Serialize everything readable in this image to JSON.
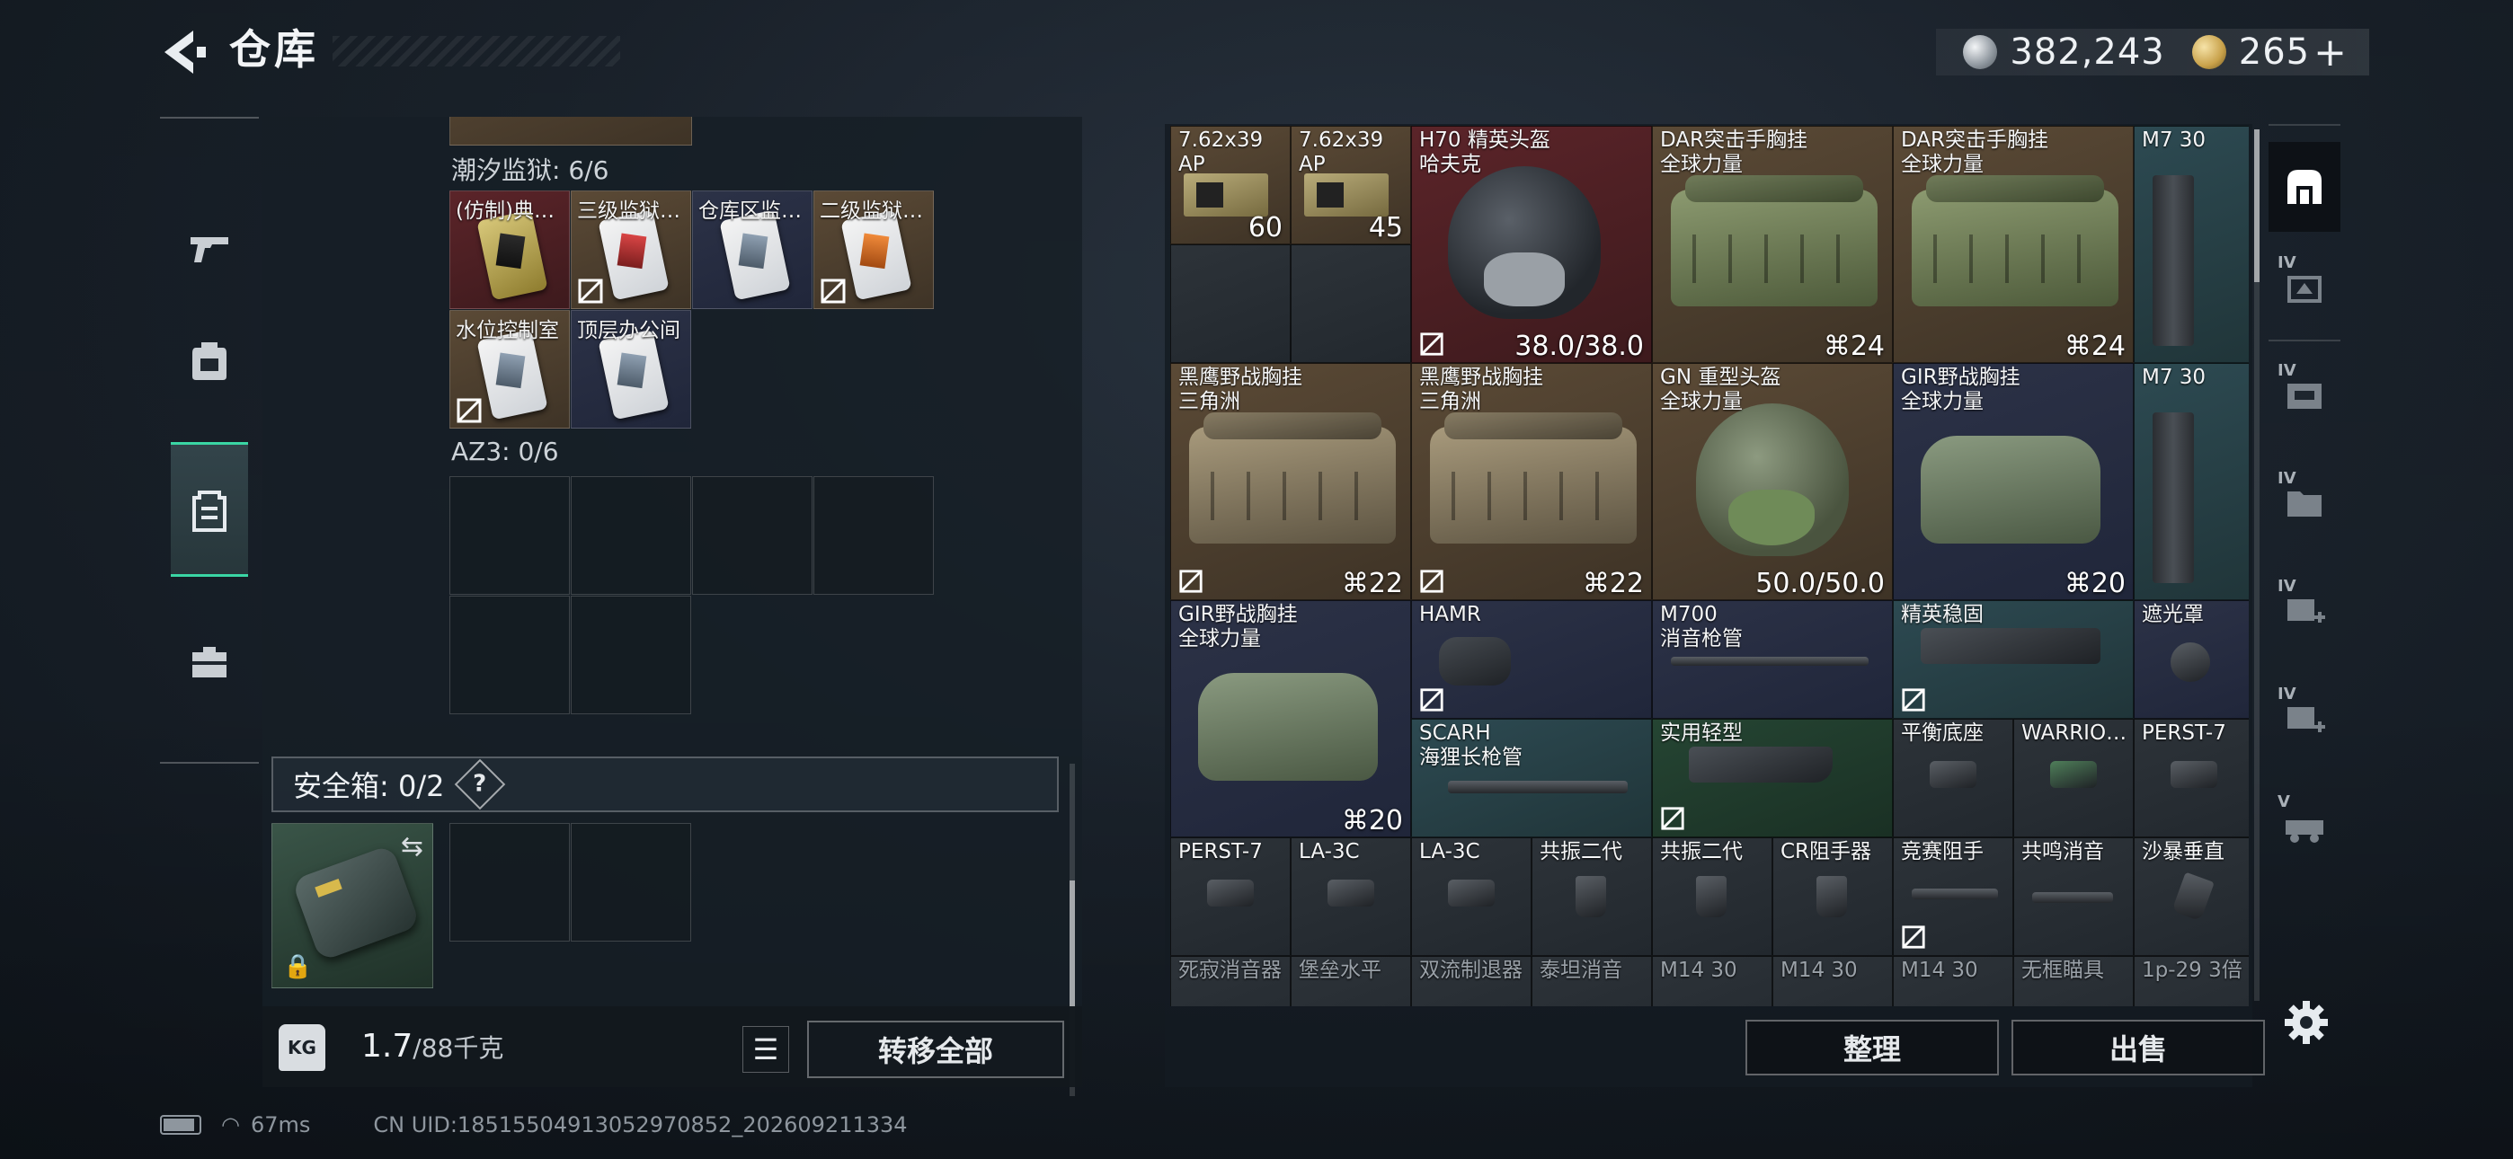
{
  "header": {
    "title": "仓库"
  },
  "currency": {
    "silver": "382,243",
    "gold": "265",
    "gold_plus": "+"
  },
  "left_tabs": [
    {
      "name": "tab-weapons",
      "icon": "pistol-icon"
    },
    {
      "name": "tab-equipment",
      "icon": "backpack-icon"
    },
    {
      "name": "tab-containers",
      "icon": "clipboard-icon",
      "active": true
    },
    {
      "name": "tab-kits",
      "icon": "toolbox-icon"
    }
  ],
  "container": {
    "section_tidal": "潮汐监狱: 6/6",
    "tidal_items": [
      {
        "label": "(仿制)典…",
        "color": "red"
      },
      {
        "label": "三级监狱…",
        "color": "gray"
      },
      {
        "label": "仓库区监…",
        "color": "navy"
      },
      {
        "label": "二级监狱…",
        "color": "brown"
      },
      {
        "label": "水位控制室",
        "color": "brown"
      },
      {
        "label": "顶层办公间",
        "color": "navy"
      }
    ],
    "section_az3": "AZ3: 0/6",
    "safe_label": "安全箱: 0/2",
    "help": "?",
    "swap_icon": "⇆",
    "lock_icon": "🔒"
  },
  "weight": {
    "icon_text": "KG",
    "current": "1.7",
    "max": "/88千克"
  },
  "actions": {
    "list_icon": "☰",
    "transfer_all": "转移全部",
    "sort": "整理",
    "sell": "出售"
  },
  "stash": {
    "items": [
      {
        "id": "ammo1",
        "name": "7.62x39\nAP",
        "qty": "60"
      },
      {
        "id": "ammo2",
        "name": "7.62x39\nAP",
        "qty": "45"
      },
      {
        "id": "h70",
        "name": "H70 精英头盔\n哈夫克",
        "durability": "38.0/38.0"
      },
      {
        "id": "dar1",
        "name": "DAR突击手胸挂\n全球力量",
        "qty": "24"
      },
      {
        "id": "dar2",
        "name": "DAR突击手胸挂\n全球力量",
        "qty": "24"
      },
      {
        "id": "m7a",
        "name": "M7 30"
      },
      {
        "id": "heiying1",
        "name": "黑鹰野战胸挂\n三角洲",
        "qty": "22"
      },
      {
        "id": "heiying2",
        "name": "黑鹰野战胸挂\n三角洲",
        "qty": "22"
      },
      {
        "id": "gn",
        "name": "GN 重型头盔\n全球力量",
        "durability": "50.0/50.0"
      },
      {
        "id": "gir1",
        "name": "GIR野战胸挂\n全球力量",
        "qty": "20"
      },
      {
        "id": "m7b",
        "name": "M7 30"
      },
      {
        "id": "gir2",
        "name": "GIR野战胸挂\n全球力量",
        "qty": "20"
      },
      {
        "id": "hamr",
        "name": "HAMR"
      },
      {
        "id": "m700",
        "name": "M700\n消音枪管"
      },
      {
        "id": "jingying",
        "name": "精英稳固"
      },
      {
        "id": "zheguang",
        "name": "遮光罩"
      },
      {
        "id": "scarh",
        "name": "SCARH\n海狸长枪管"
      },
      {
        "id": "shiyong",
        "name": "实用轻型"
      },
      {
        "id": "pingheng",
        "name": "平衡底座"
      },
      {
        "id": "warrior",
        "name": "WARRIO…"
      },
      {
        "id": "perst1",
        "name": "PERST-7"
      },
      {
        "id": "perst2",
        "name": "PERST-7"
      },
      {
        "id": "la3c1",
        "name": "LA-3C"
      },
      {
        "id": "la3c2",
        "name": "LA-3C"
      },
      {
        "id": "gongzhen1",
        "name": "共振二代"
      },
      {
        "id": "gongzhen2",
        "name": "共振二代"
      },
      {
        "id": "cr",
        "name": "CR阻手器"
      },
      {
        "id": "jingsai",
        "name": "竞赛阻手"
      },
      {
        "id": "gongming",
        "name": "共鸣消音"
      },
      {
        "id": "shabao",
        "name": "沙暴垂直"
      }
    ],
    "bottom_row": [
      "死寂消音器",
      "堡垒水平",
      "双流制退器",
      "泰坦消音",
      "M14 30",
      "M14 30",
      "M14 30",
      "无框瞄具",
      "1p-29 3倍"
    ]
  },
  "rail": [
    {
      "name": "filter-all",
      "icon": "all-items-icon",
      "tier": "",
      "active": true
    },
    {
      "name": "filter-tier4-a",
      "icon": "locked-case-icon",
      "tier": "IV"
    },
    {
      "name": "filter-tier4-b",
      "icon": "crate-icon",
      "tier": "IV"
    },
    {
      "name": "filter-tier4-c",
      "icon": "folder-icon",
      "tier": "IV"
    },
    {
      "name": "filter-tier4-d",
      "icon": "medkit-plus-icon",
      "tier": "IV"
    },
    {
      "name": "filter-tier4-e",
      "icon": "medkit-add-icon",
      "tier": "IV"
    },
    {
      "name": "filter-tier5",
      "icon": "vehicle-icon",
      "tier": "V"
    }
  ],
  "status": {
    "ping": "67ms",
    "uid": "CN UID:18515504913052970852_202609211334"
  },
  "colors": {
    "accent": "#3ad6a4",
    "gold": "#c8a14a",
    "silver": "#8d959d"
  }
}
